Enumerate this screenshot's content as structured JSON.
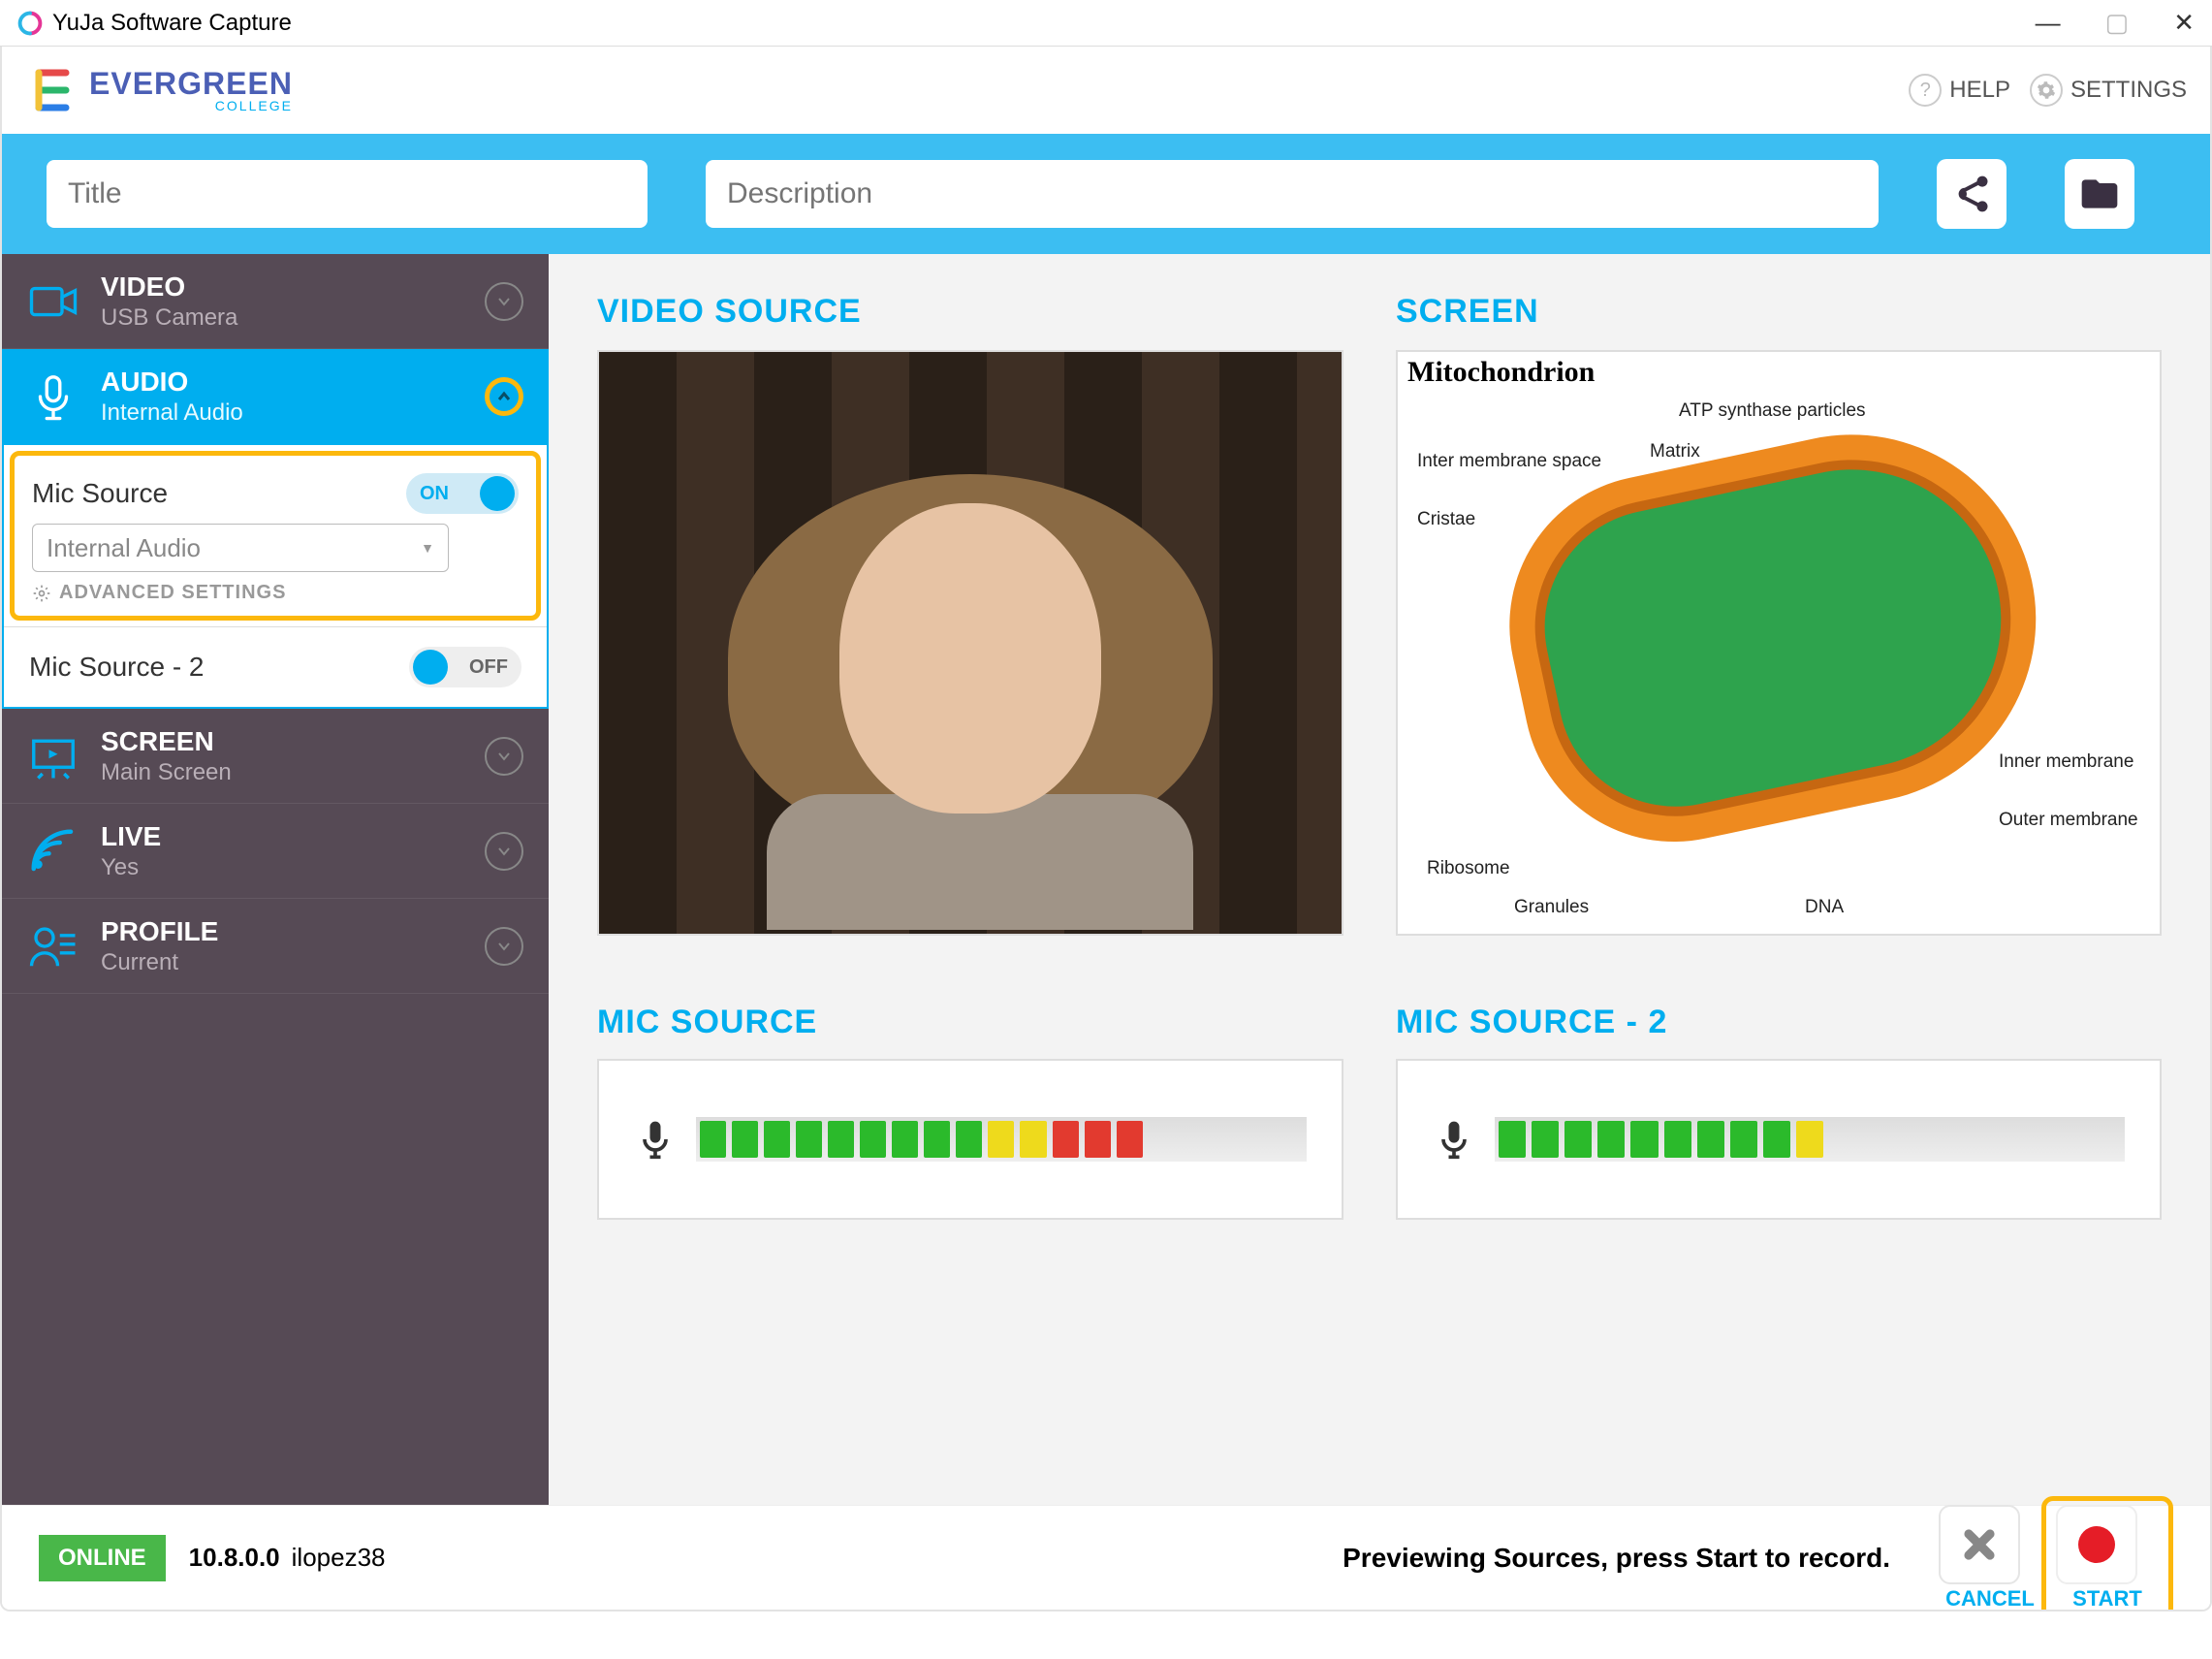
{
  "window": {
    "title": "YuJa Software Capture"
  },
  "branding": {
    "college_name": "EVERGREEN",
    "college_sub": "COLLEGE"
  },
  "header": {
    "help": "HELP",
    "settings": "SETTINGS"
  },
  "bluebar": {
    "title_placeholder": "Title",
    "desc_placeholder": "Description"
  },
  "sidebar": {
    "video": {
      "title": "VIDEO",
      "sub": "USB Camera"
    },
    "audio": {
      "title": "AUDIO",
      "sub": "Internal Audio"
    },
    "screen": {
      "title": "SCREEN",
      "sub": "Main Screen"
    },
    "live": {
      "title": "LIVE",
      "sub": "Yes"
    },
    "profile": {
      "title": "PROFILE",
      "sub": "Current"
    }
  },
  "audio_panel": {
    "mic1_label": "Mic Source",
    "mic1_toggle": "ON",
    "mic1_select": "Internal Audio",
    "advanced": "ADVANCED SETTINGS",
    "mic2_label": "Mic Source - 2",
    "mic2_toggle": "OFF"
  },
  "main": {
    "video_title": "VIDEO SOURCE",
    "screen_title": "SCREEN",
    "mic1_title": "MIC SOURCE",
    "mic2_title": "MIC SOURCE - 2"
  },
  "screen_preview": {
    "title": "Mitochondrion",
    "labels": {
      "atp": "ATP synthase particles",
      "matrix": "Matrix",
      "inter": "Inter membrane space",
      "cristae": "Cristae",
      "ribosome": "Ribosome",
      "granules": "Granules",
      "dna": "DNA",
      "inner": "Inner membrane",
      "outer": "Outer membrane"
    }
  },
  "footer": {
    "online": "ONLINE",
    "version": "10.8.0.0",
    "user": "ilopez38",
    "status": "Previewing Sources, press Start to record.",
    "cancel": "CANCEL",
    "start": "START"
  },
  "mic_levels": {
    "mic1": [
      "g",
      "g",
      "g",
      "g",
      "g",
      "g",
      "g",
      "g",
      "g",
      "y",
      "y",
      "r",
      "r",
      "r",
      "e",
      "e",
      "e",
      "e",
      "e"
    ],
    "mic2": [
      "g",
      "g",
      "g",
      "g",
      "g",
      "g",
      "g",
      "g",
      "g",
      "y",
      "e",
      "e",
      "e",
      "e",
      "e",
      "e",
      "e",
      "e",
      "e"
    ]
  }
}
